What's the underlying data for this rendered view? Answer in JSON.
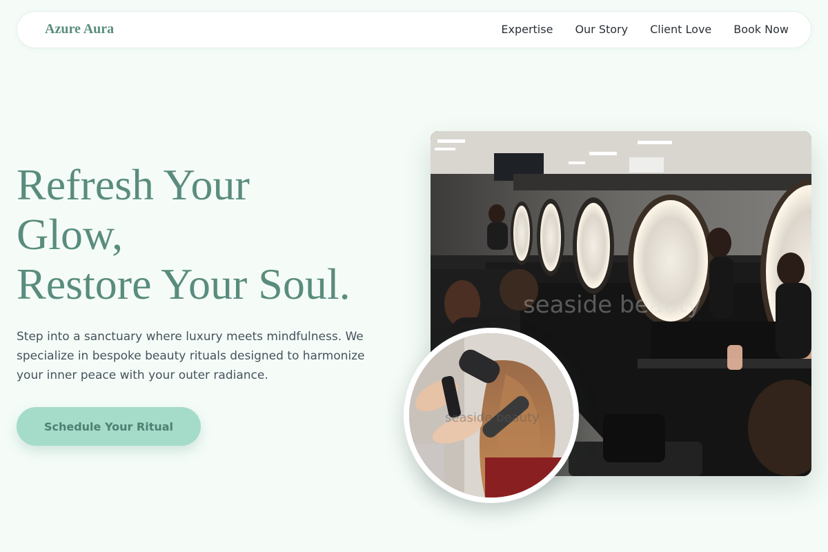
{
  "nav": {
    "brand": "Azure Aura",
    "links": [
      {
        "label": "Expertise"
      },
      {
        "label": "Our Story"
      },
      {
        "label": "Client Love"
      },
      {
        "label": "Book Now"
      }
    ]
  },
  "hero": {
    "title_lines": [
      "Refresh Your",
      "Glow,",
      "Restore Your Soul."
    ],
    "description": "Step into a sanctuary where luxury meets mindfulness. We specialize in bespoke beauty rituals designed to harmonize your inner peace with your outer radiance.",
    "cta_label": "Schedule Your Ritual"
  },
  "images": {
    "main": {
      "watermark": "seaside beauty",
      "icon": "salon-photo"
    },
    "inset": {
      "watermark": "seaside beauty",
      "icon": "hair-styling-photo"
    }
  },
  "colors": {
    "accent": "#5a8c7d",
    "cta_bg": "#a4dbc9",
    "page_bg": "#f5fcf8"
  }
}
